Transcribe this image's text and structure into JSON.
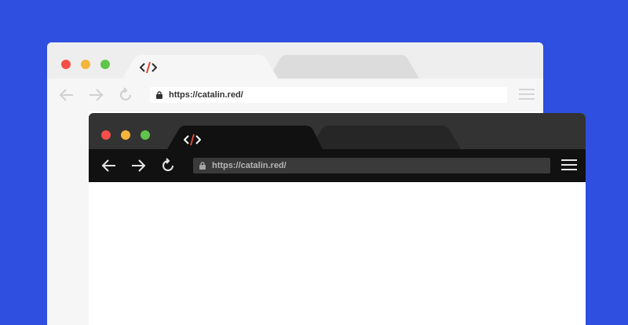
{
  "back_window": {
    "theme": "light",
    "tabs": [
      {
        "icon": "code-icon",
        "active": true
      },
      {
        "icon": "",
        "active": false
      }
    ],
    "toolbar": {
      "back_icon": "arrow-left-icon",
      "forward_icon": "arrow-right-icon",
      "reload_icon": "reload-icon",
      "url": "https://catalin.red/",
      "menu_icon": "hamburger-menu-icon"
    }
  },
  "front_window": {
    "theme": "dark",
    "tabs": [
      {
        "icon": "code-icon",
        "active": true
      },
      {
        "icon": "",
        "active": false
      }
    ],
    "toolbar": {
      "back_icon": "arrow-left-icon",
      "forward_icon": "arrow-right-icon",
      "reload_icon": "reload-icon",
      "url": "https://catalin.red/",
      "menu_icon": "hamburger-menu-icon"
    }
  },
  "colors": {
    "background": "#2f4fe0",
    "traffic_red": "#f54f48",
    "traffic_yellow": "#f5b53b",
    "traffic_green": "#61c54c",
    "logo_accent": "#e0463b"
  }
}
